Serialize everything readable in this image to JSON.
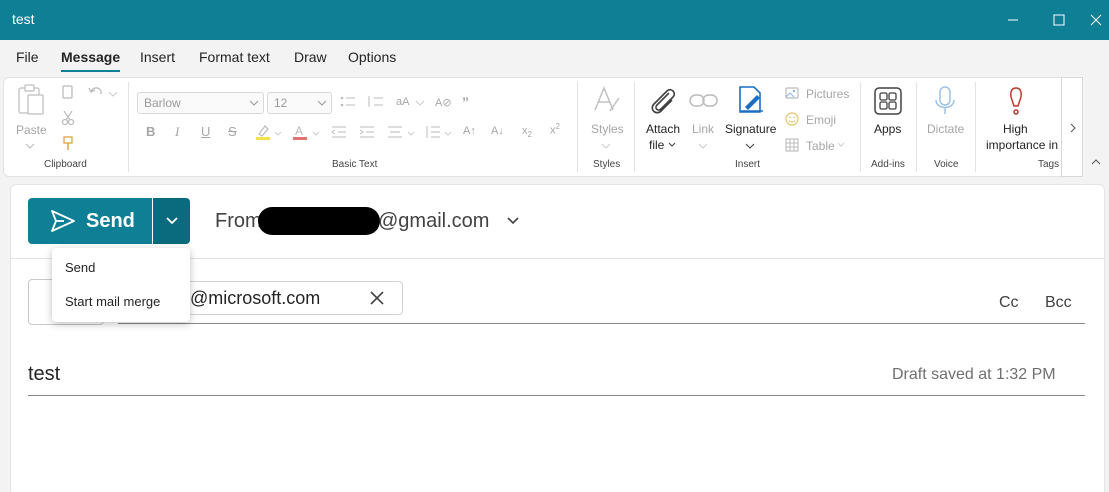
{
  "window": {
    "title": "test"
  },
  "menu_tabs": [
    "File",
    "Message",
    "Insert",
    "Format text",
    "Draw",
    "Options"
  ],
  "ribbon": {
    "clipboard": {
      "paste": "Paste",
      "group": "Clipboard"
    },
    "basic_text": {
      "font": "Barlow",
      "size": "12",
      "group": "Basic Text"
    },
    "styles": {
      "label": "Styles",
      "group": "Styles"
    },
    "insert": {
      "attach_line1": "Attach",
      "attach_line2": "file",
      "link": "Link",
      "signature": "Signature",
      "pictures": "Pictures",
      "emoji": "Emoji",
      "table": "Table",
      "group": "Insert"
    },
    "addins": {
      "apps": "Apps",
      "group": "Add-ins"
    },
    "voice": {
      "dictate": "Dictate",
      "group": "Voice"
    },
    "tags": {
      "line1": "High",
      "line2": "importance in",
      "group": "Tags"
    }
  },
  "compose": {
    "send_label": "Send",
    "from_label": "From",
    "from_email_suffix": "@gmail.com",
    "to_recipient": "rt@microsoft.com",
    "cc_label": "Cc",
    "bcc_label": "Bcc",
    "subject": "test",
    "draft_status": "Draft saved at 1:32 PM"
  },
  "send_menu": {
    "items": [
      "Send",
      "Start mail merge"
    ]
  },
  "colors": {
    "accent": "#0f7f96",
    "accent_dark": "#0a6a7e"
  }
}
